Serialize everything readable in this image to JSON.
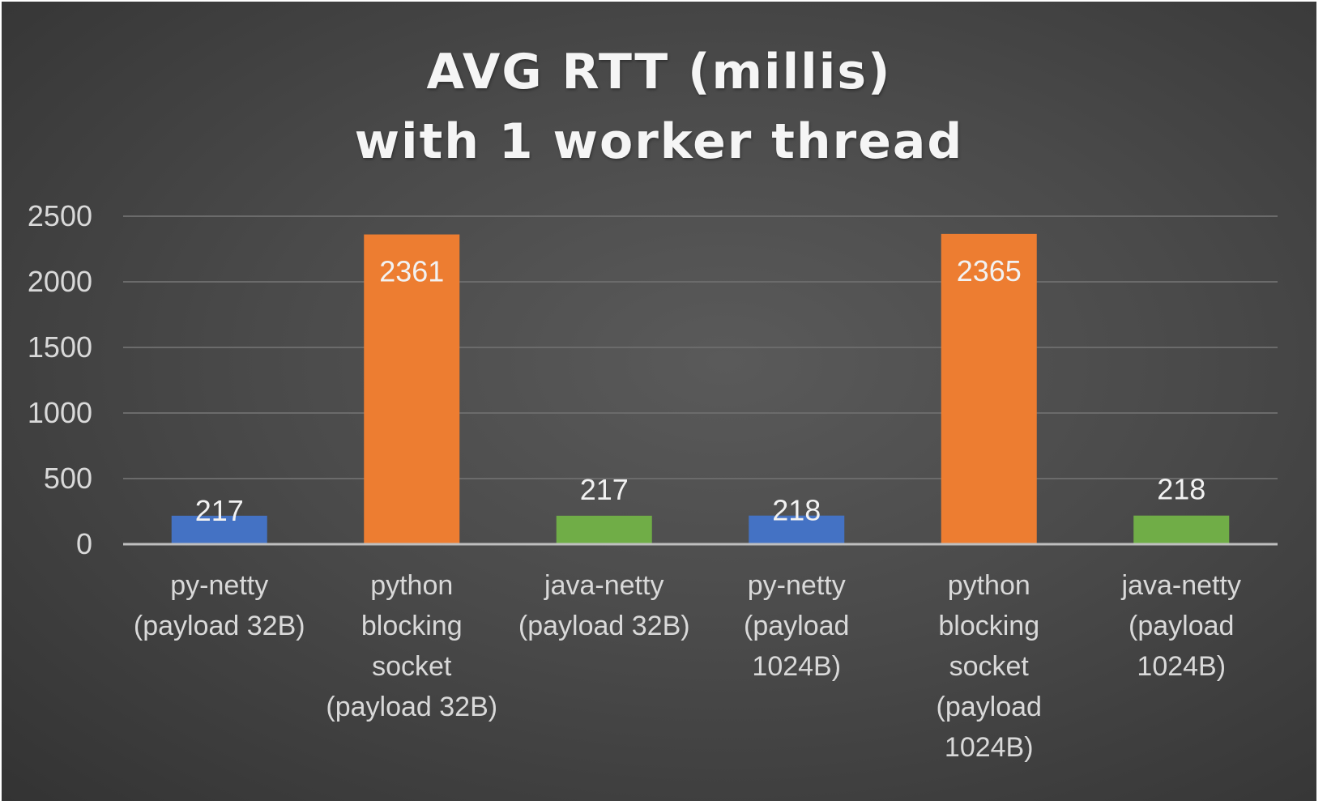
{
  "chart_data": {
    "type": "bar",
    "title": [
      "AVG RTT (millis)",
      "with 1 worker thread"
    ],
    "xlabel": "",
    "ylabel": "",
    "ylim": [
      0,
      2500
    ],
    "yticks": [
      "0",
      "500",
      "1000",
      "1500",
      "2000",
      "2500"
    ],
    "grid": true,
    "categories": [
      [
        "py-netty",
        "(payload 32B)"
      ],
      [
        "python",
        "blocking",
        "socket",
        "(payload 32B)"
      ],
      [
        "java-netty",
        "(payload 32B)"
      ],
      [
        "py-netty",
        "(payload",
        "1024B)"
      ],
      [
        "python",
        "blocking",
        "socket",
        "(payload",
        "1024B)"
      ],
      [
        "java-netty",
        "(payload",
        "1024B)"
      ]
    ],
    "values": [
      217,
      2361,
      217,
      218,
      2365,
      218
    ],
    "colors": [
      "#4472c4",
      "#ed7d31",
      "#70ad47",
      "#4472c4",
      "#ed7d31",
      "#70ad47"
    ]
  }
}
